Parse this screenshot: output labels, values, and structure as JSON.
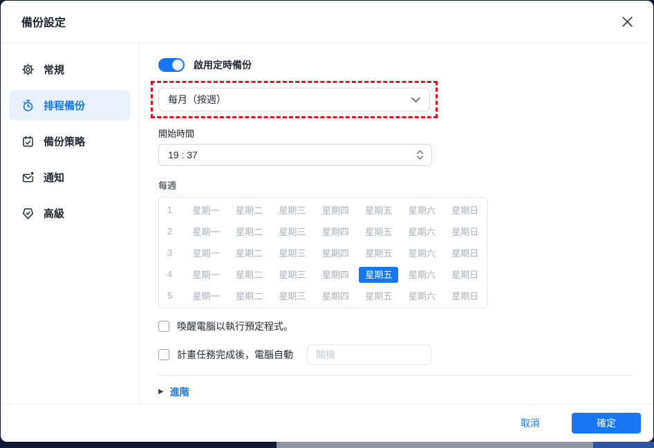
{
  "dialog": {
    "title": "備份設定"
  },
  "sidebar": {
    "items": [
      {
        "label": "常規",
        "icon": "gear-icon",
        "selected": false
      },
      {
        "label": "排程備份",
        "icon": "stopwatch-icon",
        "selected": true
      },
      {
        "label": "備份策略",
        "icon": "calendar-check-icon",
        "selected": false
      },
      {
        "label": "通知",
        "icon": "mail-notification-icon",
        "selected": false
      },
      {
        "label": "高級",
        "icon": "badge-check-icon",
        "selected": false
      }
    ]
  },
  "content": {
    "schedule_toggle": {
      "label": "啟用定時備份",
      "state": "on"
    },
    "frequency_dropdown": {
      "value": "每月（按週）",
      "highlighted": true
    },
    "start_time": {
      "label": "開始時間",
      "value": "19 : 37"
    },
    "weekly": {
      "label": "每週",
      "row_numbers": [
        "1",
        "2",
        "3",
        "4",
        "5"
      ],
      "days": [
        "星期一",
        "星期二",
        "星期三",
        "星期四",
        "星期五",
        "星期六",
        "星期日"
      ],
      "selected": {
        "row": 4,
        "day": "星期五"
      }
    },
    "wake_checkbox": {
      "label": "喚醒電腦以執行預定程式。",
      "checked": false
    },
    "auto_action_checkbox": {
      "label": "計畫任務完成後，電腦自動",
      "checked": false,
      "action_placeholder": "關機"
    },
    "advanced": {
      "label": "進階",
      "expanded": false,
      "arrow": "▶"
    }
  },
  "footer": {
    "cancel_label": "取消",
    "ok_label": "確定"
  },
  "colors": {
    "accent": "#1677f0",
    "selected_item_bg": "#e7f2fd",
    "highlight_border": "#e81123",
    "week_text": "#a9b1bc",
    "background_navy": "#101b33",
    "background_gray": "#8e94a1",
    "background_blue": "#2a54a3"
  }
}
